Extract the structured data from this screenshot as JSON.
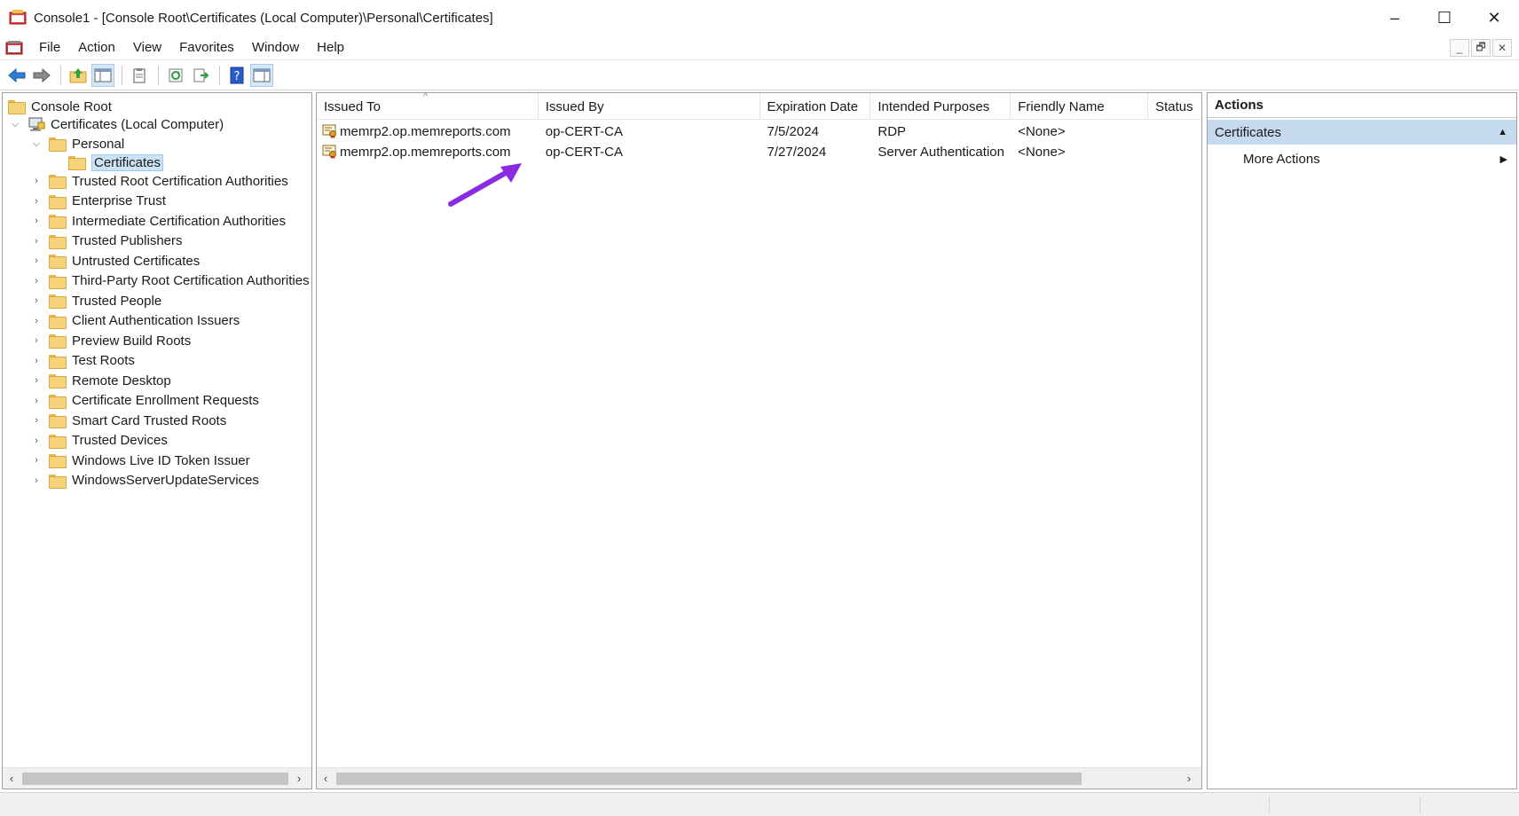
{
  "window": {
    "title": "Console1 - [Console Root\\Certificates (Local Computer)\\Personal\\Certificates]",
    "minimize": "–",
    "maximize": "☐",
    "close": "✕"
  },
  "menu": {
    "items": [
      "File",
      "Action",
      "View",
      "Favorites",
      "Window",
      "Help"
    ],
    "mdi": [
      "_",
      "🗗",
      "✕"
    ]
  },
  "toolbar": {
    "icons": [
      "back-icon",
      "forward-icon",
      "up-one-level-icon",
      "show-hide-console-tree-icon",
      "properties-icon",
      "refresh-icon",
      "export-list-icon",
      "help-icon",
      "show-hide-action-pane-icon"
    ]
  },
  "tree": {
    "root": "Console Root",
    "computer": "Certificates (Local Computer)",
    "personal": "Personal",
    "selected": "Certificates",
    "stores": [
      "Trusted Root Certification Authorities",
      "Enterprise Trust",
      "Intermediate Certification Authorities",
      "Trusted Publishers",
      "Untrusted Certificates",
      "Third-Party Root Certification Authorities",
      "Trusted People",
      "Client Authentication Issuers",
      "Preview Build Roots",
      "Test Roots",
      "Remote Desktop",
      "Certificate Enrollment Requests",
      "Smart Card Trusted Roots",
      "Trusted Devices",
      "Windows Live ID Token Issuer",
      "WindowsServerUpdateServices"
    ]
  },
  "list": {
    "columns": [
      "Issued To",
      "Issued By",
      "Expiration Date",
      "Intended Purposes",
      "Friendly Name",
      "Status"
    ],
    "rows": [
      {
        "issued_to": "memrp2.op.memreports.com",
        "issued_by": "op-CERT-CA",
        "expiration": "7/5/2024",
        "purposes": "RDP",
        "friendly": "<None>",
        "status": ""
      },
      {
        "issued_to": "memrp2.op.memreports.com",
        "issued_by": "op-CERT-CA",
        "expiration": "7/27/2024",
        "purposes": "Server Authentication",
        "friendly": "<None>",
        "status": ""
      }
    ]
  },
  "actions": {
    "title": "Actions",
    "section": "Certificates",
    "items": [
      "More Actions"
    ]
  },
  "colors": {
    "selection": "#cce4f7",
    "action_section": "#c5d9ef",
    "annotation_arrow": "#8a2be2"
  }
}
